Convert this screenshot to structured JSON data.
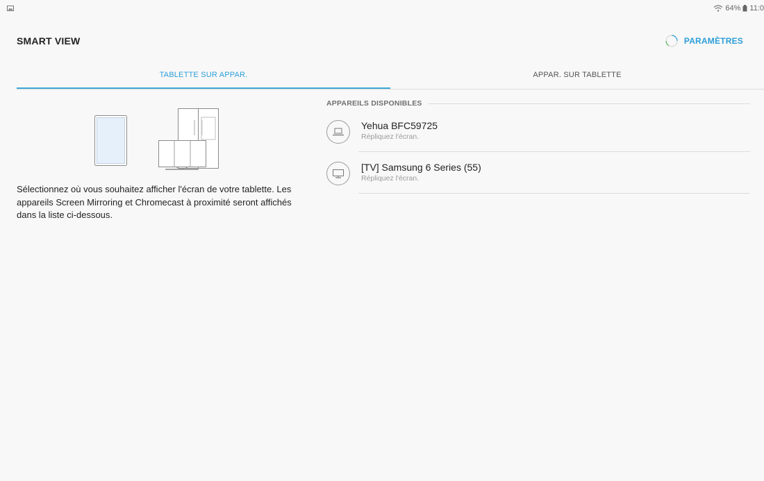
{
  "status": {
    "battery_text": "64%",
    "time": "11:0"
  },
  "header": {
    "title": "SMART VIEW",
    "settings_label": "PARAMÈTRES"
  },
  "tabs": [
    {
      "label": "TABLETTE SUR APPAR.",
      "active": true
    },
    {
      "label": "APPAR. SUR TABLETTE",
      "active": false
    }
  ],
  "left_panel": {
    "instructions": "Sélectionnez où vous souhaitez afficher l'écran de votre tablette. Les appareils Screen Mirroring et Chromecast à proximité seront affichés dans la liste ci-dessous."
  },
  "devices_section": {
    "title": "APPAREILS DISPONIBLES",
    "items": [
      {
        "name": "Yehua BFC59725",
        "subtitle": "Répliquez l'écran.",
        "icon": "laptop-icon"
      },
      {
        "name": "[TV] Samsung 6 Series (55)",
        "subtitle": "Répliquez l'écran.",
        "icon": "tv-icon"
      }
    ]
  },
  "colors": {
    "accent": "#2b9ed8",
    "background": "#f8f8f8",
    "divider": "#dcdcdc"
  }
}
